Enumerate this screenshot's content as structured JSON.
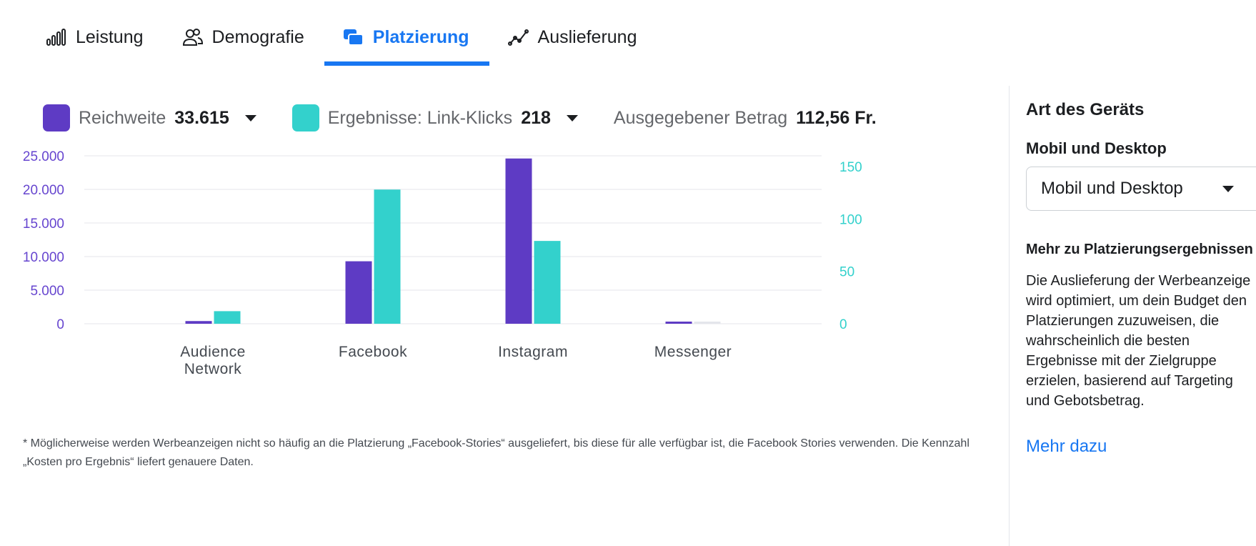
{
  "tabs": [
    {
      "label": "Leistung",
      "icon": "bar-chart-icon",
      "active": false
    },
    {
      "label": "Demografie",
      "icon": "people-icon",
      "active": false
    },
    {
      "label": "Platzierung",
      "icon": "placement-icon",
      "active": true
    },
    {
      "label": "Auslieferung",
      "icon": "delivery-icon",
      "active": false
    }
  ],
  "legend": {
    "reach": {
      "label": "Reichweite",
      "value": "33.615",
      "color": "#5e3bc4"
    },
    "results": {
      "label": "Ergebnisse: Link-Klicks",
      "value": "218",
      "color": "#33d1cc"
    },
    "spend": {
      "label": "Ausgegebener Betrag",
      "value": "112,56 Fr."
    }
  },
  "chart_data": {
    "type": "bar",
    "categories": [
      "Audience Network",
      "Facebook",
      "Instagram",
      "Messenger"
    ],
    "series": [
      {
        "name": "Reichweite",
        "axis": "left",
        "color": "#5e3bc4",
        "values": [
          400,
          9300,
          24600,
          150
        ]
      },
      {
        "name": "Ergebnisse: Link-Klicks",
        "axis": "right",
        "color": "#33d1cc",
        "values": [
          12,
          128,
          79,
          1
        ]
      }
    ],
    "y_left": {
      "ticks": [
        "0",
        "5.000",
        "10.000",
        "15.000",
        "20.000",
        "25.000"
      ],
      "tick_values": [
        0,
        5000,
        10000,
        15000,
        20000,
        25000
      ],
      "ylim": [
        0,
        25000
      ],
      "color": "#6645cf"
    },
    "y_right": {
      "ticks": [
        "0",
        "50",
        "100",
        "150"
      ],
      "tick_values": [
        0,
        50,
        100,
        150
      ],
      "ylim": [
        0,
        150
      ],
      "color": "#33d1cc"
    },
    "category_labels": [
      [
        "Audience",
        "Network"
      ],
      [
        "Facebook"
      ],
      [
        "Instagram"
      ],
      [
        "Messenger"
      ]
    ],
    "grid": true
  },
  "note": "* Möglicherweise werden Werbeanzeigen nicht so häufig an die Platzierung „Facebook-Stories“ ausgeliefert, bis diese für alle verfügbar ist, die Facebook Stories verwenden. Die Kennzahl „Kosten pro Ergebnis“ liefert genauere Daten.",
  "side": {
    "title": "Art des Geräts",
    "select_label": "Mobil und Desktop",
    "select_value": "Mobil und Desktop",
    "more_heading": "Mehr zu Platzierungsergebnissen",
    "description": "Die Auslieferung der Werbeanzeige wird optimiert, um dein Budget den Platzierungen zuzuweisen, die wahrscheinlich die besten Ergebnisse mit der Zielgruppe erzielen, basierend auf Targeting und Gebotsbetrag.",
    "link": "Mehr dazu"
  }
}
